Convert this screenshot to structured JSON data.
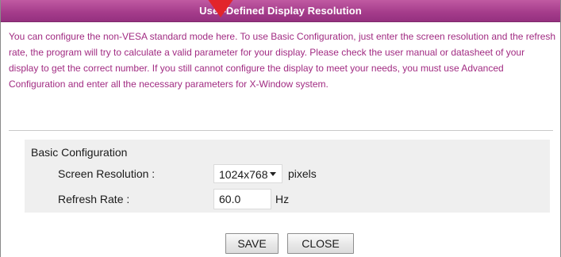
{
  "dialog": {
    "title": "User-Defined Display Resolution",
    "description": "You can configure the non-VESA standard mode here. To use Basic Configuration, just enter the screen resolution and the refresh rate, the program will try to calculate a valid parameter for your display. Please check the user manual or datasheet of your display to get the correct number. If you still cannot configure the display to meet your needs, you must use Advanced Configuration and enter all the necessary parameters for X-Window system."
  },
  "basic_config": {
    "heading": "Basic Configuration",
    "resolution": {
      "label": "Screen Resolution :",
      "value": "1024x768",
      "unit": "pixels"
    },
    "refresh": {
      "label": "Refresh Rate :",
      "value": "60.0",
      "unit": "Hz"
    }
  },
  "buttons": {
    "save": "SAVE",
    "close": "CLOSE"
  },
  "colors": {
    "title_bar": "#a63d8c",
    "description_text": "#a12b82",
    "cursor_marker": "#e2252b"
  }
}
